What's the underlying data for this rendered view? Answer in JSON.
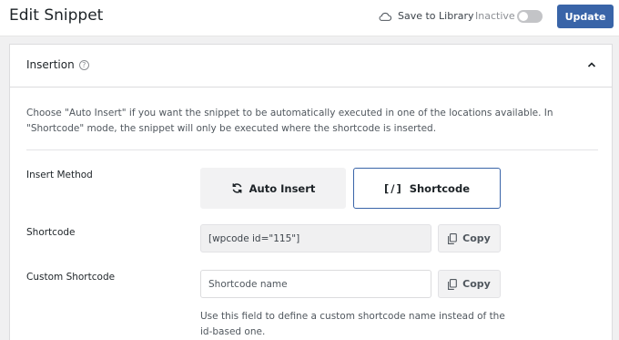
{
  "header": {
    "title": "Edit Snippet",
    "save_to_library": "Save to Library",
    "status_label": "Inactive",
    "status_active": false,
    "update_label": "Update"
  },
  "panel": {
    "title": "Insertion",
    "intro": "Choose \"Auto Insert\" if you want the snippet to be automatically executed in one of the locations available. In \"Shortcode\" mode, the snippet will only be executed where the shortcode is inserted.",
    "insert_method": {
      "label": "Insert Method",
      "options": [
        "Auto Insert",
        "Shortcode"
      ],
      "selected": "Shortcode",
      "auto_label": "Auto Insert",
      "shortcode_glyph": "[/]",
      "shortcode_label": "Shortcode"
    },
    "shortcode": {
      "label": "Shortcode",
      "value": "[wpcode id=\"115\"]",
      "copy_label": "Copy"
    },
    "custom_shortcode": {
      "label": "Custom Shortcode",
      "placeholder": "Shortcode name",
      "value": "",
      "copy_label": "Copy",
      "help": "Use this field to define a custom shortcode name instead of the id-based one."
    }
  },
  "colors": {
    "accent": "#3964a8",
    "background": "#f0f0f1"
  }
}
